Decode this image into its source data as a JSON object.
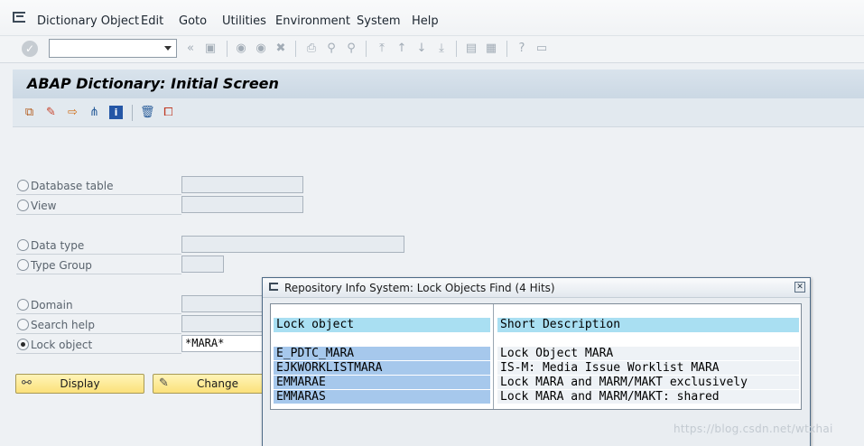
{
  "menubar": {
    "items": [
      "Dictionary Object",
      "Edit",
      "Goto",
      "Utilities",
      "Environment",
      "System",
      "Help"
    ]
  },
  "toolbar": {
    "command_field_value": "",
    "icons": [
      "enter-icon",
      "back-icon",
      "exit-icon",
      "cancel-icon",
      "print-icon",
      "find-icon",
      "find-next-icon",
      "first-page-icon",
      "previous-page-icon",
      "next-page-icon",
      "last-page-icon",
      "create-session-icon",
      "shortcut-icon",
      "help-icon",
      "customize-layout-icon"
    ]
  },
  "title": "ABAP Dictionary: Initial Screen",
  "object_types": [
    {
      "label": "Database table",
      "value": "",
      "selected": false
    },
    {
      "label": "View",
      "value": "",
      "selected": false
    },
    {
      "label": "Data type",
      "value": "",
      "selected": false
    },
    {
      "label": "Type Group",
      "value": "",
      "selected": false
    },
    {
      "label": "Domain",
      "value": "",
      "selected": false
    },
    {
      "label": "Search help",
      "value": "",
      "selected": false
    },
    {
      "label": "Lock object",
      "value": "*MARA*",
      "selected": true
    }
  ],
  "buttons": {
    "display": "Display",
    "change": "Change"
  },
  "dialog": {
    "title": "Repository Info System: Lock Objects Find (4 Hits)",
    "columns": [
      "Lock object",
      "Short Description"
    ],
    "rows": [
      {
        "name": "E_PDTC_MARA",
        "desc": "Lock Object MARA"
      },
      {
        "name": "EJKWORKLISTMARA",
        "desc": "IS-M: Media Issue Worklist MARA"
      },
      {
        "name": "EMMARAE",
        "desc": "Lock MARA and MARM/MAKT exclusively"
      },
      {
        "name": "EMMARAS",
        "desc": "Lock MARA and MARM/MAKT: shared"
      }
    ]
  },
  "watermark": "https://blog.csdn.net/wtxhai",
  "colors": {
    "title_bg": "#cfdbe6",
    "button_bg": "#fbe17a",
    "header_cell": "#a9dff2",
    "key_cell": "#a6c8ec"
  }
}
